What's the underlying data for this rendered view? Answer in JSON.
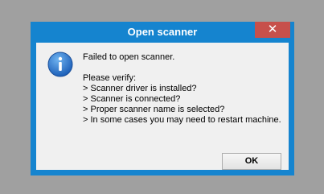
{
  "dialog": {
    "title": "Open scanner",
    "close_label": "✕",
    "icon": "info-icon",
    "message_lines": [
      "Failed to open scanner.",
      "",
      "Please verify:",
      "> Scanner driver is installed?",
      "> Scanner is connected?",
      "> Proper scanner name is selected?",
      "> In some cases you may need to restart machine."
    ],
    "ok_label": "OK"
  },
  "colors": {
    "titlebar": "#1584cf",
    "close_button": "#c7504b",
    "background": "#a0a0a0",
    "client": "#f0f0f0"
  }
}
